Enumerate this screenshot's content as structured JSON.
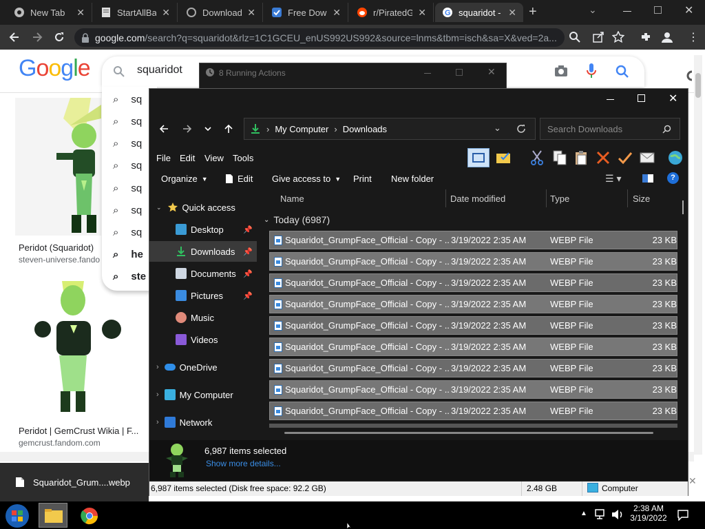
{
  "browser": {
    "tabs": [
      {
        "label": "New Tab"
      },
      {
        "label": "StartAllBac"
      },
      {
        "label": "Download"
      },
      {
        "label": "Free Down"
      },
      {
        "label": "r/PiratedGa"
      },
      {
        "label": "squaridot -"
      }
    ],
    "url_main": "google.com",
    "url_rest": "/search?q=squaridot&rlz=1C1GCEU_enUS992US992&source=lnms&tbm=isch&sa=X&ved=2a...",
    "new_tab_symbol": "+"
  },
  "google": {
    "logo": "Google",
    "query": "squaridot",
    "suggestions": [
      "sq",
      "sq",
      "sq",
      "sq",
      "sq",
      "sq",
      "sq",
      "he",
      "ste"
    ],
    "results": [
      {
        "title": "Peridot (Squaridot)",
        "source": "steven-universe.fando"
      },
      {
        "title": "Peridot | GemCrust Wikia | F...",
        "source": "gemcrust.fandom.com"
      }
    ]
  },
  "running_actions": {
    "title": "8 Running Actions"
  },
  "explorer": {
    "breadcrumb": [
      "My Computer",
      "Downloads"
    ],
    "search_placeholder": "Search Downloads",
    "menus": [
      "File",
      "Edit",
      "View",
      "Tools"
    ],
    "commands": {
      "organize": "Organize",
      "edit": "Edit",
      "give_access": "Give access to",
      "print": "Print",
      "new_folder": "New folder"
    },
    "nav": [
      {
        "label": "Quick access"
      },
      {
        "label": "Desktop"
      },
      {
        "label": "Downloads"
      },
      {
        "label": "Documents"
      },
      {
        "label": "Pictures"
      },
      {
        "label": "Music"
      },
      {
        "label": "Videos"
      },
      {
        "label": "OneDrive"
      },
      {
        "label": "My Computer"
      },
      {
        "label": "Network"
      }
    ],
    "columns": {
      "name": "Name",
      "date": "Date modified",
      "type": "Type",
      "size": "Size"
    },
    "group_label": "Today (6987)",
    "files": [
      {
        "name": "Squaridot_GrumpFace_Official - Copy - ...",
        "date": "3/19/2022 2:35 AM",
        "type": "WEBP File",
        "size": "23 KB"
      },
      {
        "name": "Squaridot_GrumpFace_Official - Copy - ...",
        "date": "3/19/2022 2:35 AM",
        "type": "WEBP File",
        "size": "23 KB"
      },
      {
        "name": "Squaridot_GrumpFace_Official - Copy - ...",
        "date": "3/19/2022 2:35 AM",
        "type": "WEBP File",
        "size": "23 KB"
      },
      {
        "name": "Squaridot_GrumpFace_Official - Copy - ...",
        "date": "3/19/2022 2:35 AM",
        "type": "WEBP File",
        "size": "23 KB"
      },
      {
        "name": "Squaridot_GrumpFace_Official - Copy - ...",
        "date": "3/19/2022 2:35 AM",
        "type": "WEBP File",
        "size": "23 KB"
      },
      {
        "name": "Squaridot_GrumpFace_Official - Copy - ...",
        "date": "3/19/2022 2:35 AM",
        "type": "WEBP File",
        "size": "23 KB"
      },
      {
        "name": "Squaridot_GrumpFace_Official - Copy - ...",
        "date": "3/19/2022 2:35 AM",
        "type": "WEBP File",
        "size": "23 KB"
      },
      {
        "name": "Squaridot_GrumpFace_Official - Copy - ...",
        "date": "3/19/2022 2:35 AM",
        "type": "WEBP File",
        "size": "23 KB"
      },
      {
        "name": "Squaridot_GrumpFace_Official - Copy - ...",
        "date": "3/19/2022 2:35 AM",
        "type": "WEBP File",
        "size": "23 KB"
      }
    ],
    "details": {
      "selected": "6,987 items selected",
      "more": "Show more details..."
    },
    "status": {
      "left": "6,987 items selected (Disk free space: 92.2 GB)",
      "size": "2.48 GB",
      "location": "Computer"
    }
  },
  "download_shelf": {
    "filename": "Squaridot_Grum....webp"
  },
  "taskbar": {
    "time": "2:38 AM",
    "date": "3/19/2022"
  }
}
